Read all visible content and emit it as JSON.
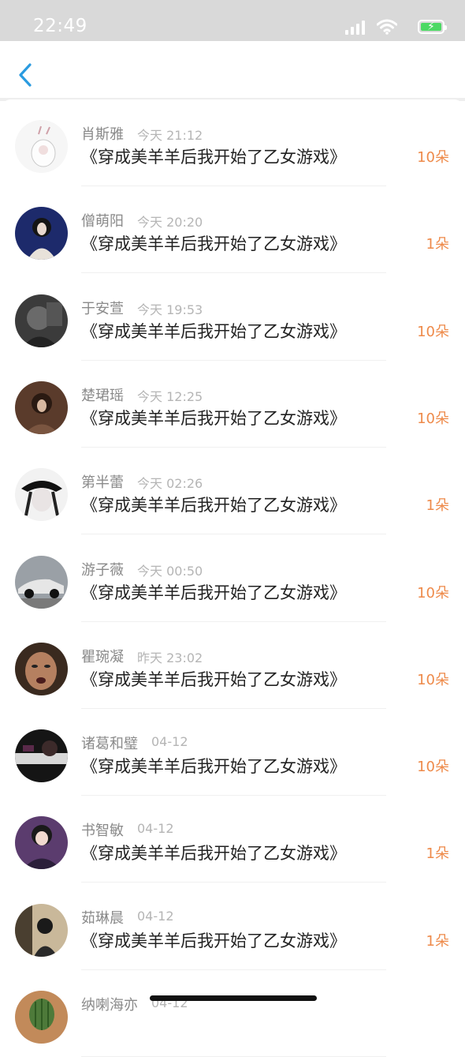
{
  "status_bar": {
    "time": "22:49"
  },
  "nav": {
    "back_icon": "chevron-left-icon"
  },
  "colors": {
    "accent": "#2a9be0",
    "count": "#ee8a4a"
  },
  "list": [
    {
      "name": "肖斯雅",
      "time": "今天 21:12",
      "title": "《穿成美羊羊后我开始了乙女游戏》",
      "count": "10朵",
      "avatar": "rabbit-bottle"
    },
    {
      "name": "僧萌阳",
      "time": "今天 20:20",
      "title": "《穿成美羊羊后我开始了乙女游戏》",
      "count": "1朵",
      "avatar": "girl-blue"
    },
    {
      "name": "于安萱",
      "time": "今天 19:53",
      "title": "《穿成美羊羊后我开始了乙女游戏》",
      "count": "10朵",
      "avatar": "dark-portrait"
    },
    {
      "name": "楚珺瑶",
      "time": "今天 12:25",
      "title": "《穿成美羊羊后我开始了乙女游戏》",
      "count": "10朵",
      "avatar": "brown-portrait"
    },
    {
      "name": "第半蕾",
      "time": "今天 02:26",
      "title": "《穿成美羊羊后我开始了乙女游戏》",
      "count": "1朵",
      "avatar": "anime-hat"
    },
    {
      "name": "游子薇",
      "time": "今天 00:50",
      "title": "《穿成美羊羊后我开始了乙女游戏》",
      "count": "10朵",
      "avatar": "car"
    },
    {
      "name": "瞿琬凝",
      "time": "昨天 23:02",
      "title": "《穿成美羊羊后我开始了乙女游戏》",
      "count": "10朵",
      "avatar": "face-close"
    },
    {
      "name": "诸葛和璧",
      "time": "04-12",
      "title": "《穿成美羊羊后我开始了乙女游戏》",
      "count": "10朵",
      "avatar": "dark-scene"
    },
    {
      "name": "书智敏",
      "time": "04-12",
      "title": "《穿成美羊羊后我开始了乙女游戏》",
      "count": "1朵",
      "avatar": "girl-purple"
    },
    {
      "name": "茹琳晨",
      "time": "04-12",
      "title": "《穿成美羊羊后我开始了乙女游戏》",
      "count": "1朵",
      "avatar": "girl-window"
    },
    {
      "name": "纳喇海亦",
      "time": "04-12",
      "title": "",
      "count": "",
      "avatar": "cactus"
    }
  ]
}
